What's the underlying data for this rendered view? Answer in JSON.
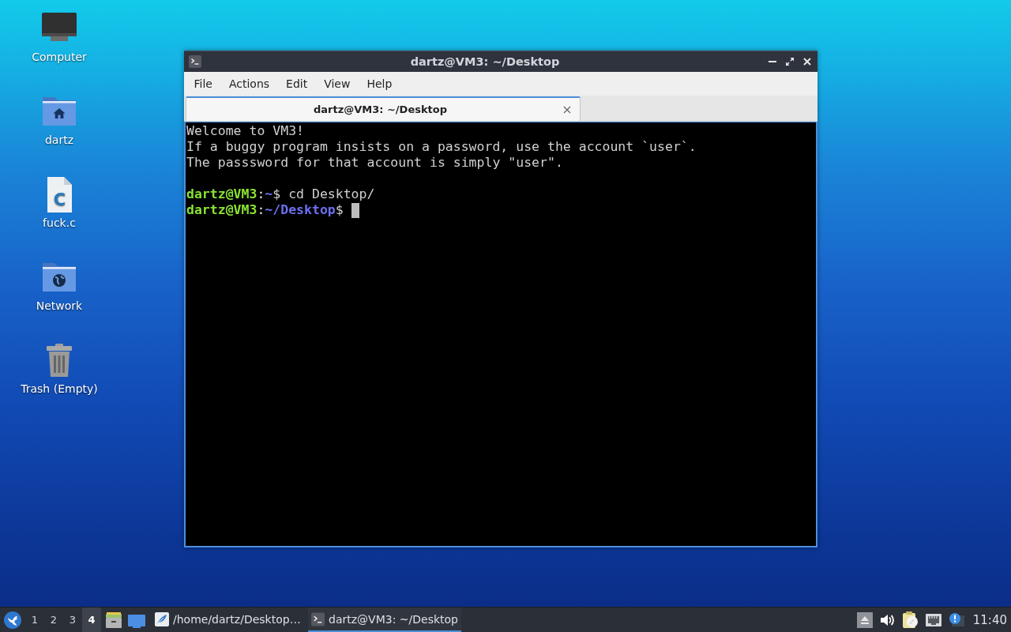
{
  "desktop": {
    "icons": [
      {
        "kind": "computer",
        "label": "Computer"
      },
      {
        "kind": "home-folder",
        "label": "dartz"
      },
      {
        "kind": "source-file",
        "label": "fuck.c",
        "glyph": "C"
      },
      {
        "kind": "network-folder",
        "label": "Network"
      },
      {
        "kind": "trash",
        "label": "Trash (Empty)"
      }
    ]
  },
  "window": {
    "title": "dartz@VM3: ~/Desktop",
    "menu": [
      "File",
      "Actions",
      "Edit",
      "View",
      "Help"
    ],
    "tabs": [
      {
        "label": "dartz@VM3: ~/Desktop",
        "selected": true
      }
    ],
    "terminal": {
      "output": [
        "Welcome to VM3!",
        "If a buggy program insists on a password, use the account `user`.",
        "The passsword for that account is simply \"user\"."
      ],
      "prompts": [
        {
          "user": "dartz@VM3",
          "separator": ":",
          "path": "~",
          "symbol": "$",
          "command": "cd Desktop/"
        },
        {
          "user": "dartz@VM3",
          "separator": ":",
          "path": "~/Desktop",
          "symbol": "$"
        }
      ],
      "cursor": true
    }
  },
  "taskbar": {
    "launchers": [
      {
        "kind": "app-menu"
      }
    ],
    "workspaces": [
      {
        "label": "1",
        "selected": false
      },
      {
        "label": "2",
        "selected": false
      },
      {
        "label": "3",
        "selected": false
      },
      {
        "label": "4",
        "selected": true
      }
    ],
    "quicklaunch": [
      {
        "kind": "file-manager"
      },
      {
        "kind": "show-desktop"
      }
    ],
    "tasks": [
      {
        "kind": "editor",
        "label": "/home/dartz/Desktop…",
        "selected": false
      },
      {
        "kind": "terminal",
        "label": "dartz@VM3: ~/Desktop",
        "selected": true
      }
    ],
    "tray": [
      {
        "kind": "eject"
      },
      {
        "kind": "volume"
      },
      {
        "kind": "clipboard"
      },
      {
        "kind": "network"
      },
      {
        "kind": "notification"
      }
    ],
    "clock": "11:40"
  }
}
